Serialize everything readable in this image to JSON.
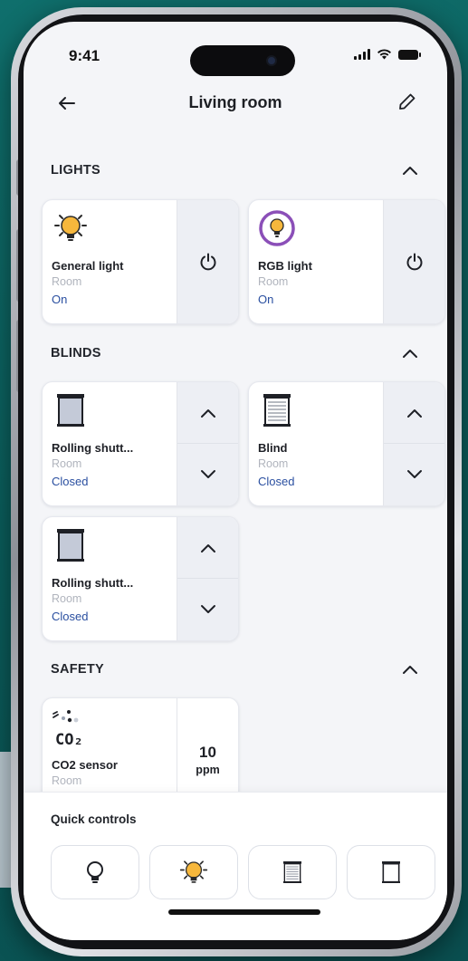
{
  "status_bar": {
    "time": "9:41"
  },
  "header": {
    "title": "Living room"
  },
  "sections": {
    "lights": {
      "title": "LIGHTS",
      "devices": [
        {
          "name": "General light",
          "room": "Room",
          "state": "On",
          "icon": "bulb-on-icon",
          "action": "power-icon"
        },
        {
          "name": "RGB light",
          "room": "Room",
          "state": "On",
          "icon": "rgb-bulb-icon",
          "action": "power-icon"
        }
      ]
    },
    "blinds": {
      "title": "BLINDS",
      "devices": [
        {
          "name": "Rolling shutt...",
          "room": "Room",
          "state": "Closed",
          "icon": "rolling-shutter-icon"
        },
        {
          "name": "Blind",
          "room": "Room",
          "state": "Closed",
          "icon": "blind-icon"
        },
        {
          "name": "Rolling shutt...",
          "room": "Room",
          "state": "Closed",
          "icon": "rolling-shutter-icon"
        }
      ]
    },
    "safety": {
      "title": "SAFETY",
      "devices": [
        {
          "name": "CO2 sensor",
          "room": "Room",
          "icon_label": "CO₂",
          "value": "10",
          "unit": "ppm",
          "icon": "co2-sensor-icon"
        }
      ]
    }
  },
  "quick_controls": {
    "title": "Quick controls",
    "buttons": [
      "bulb-outline-icon",
      "bulb-on-icon",
      "blind-icon",
      "rolling-shutter-outline-icon"
    ]
  },
  "colors": {
    "accent_blue": "#2a4fa0",
    "bulb_yellow": "#f6b73c",
    "rgb_ring": "#8b4fb8",
    "background": "#f4f5f8",
    "card_side": "#edeff4"
  }
}
